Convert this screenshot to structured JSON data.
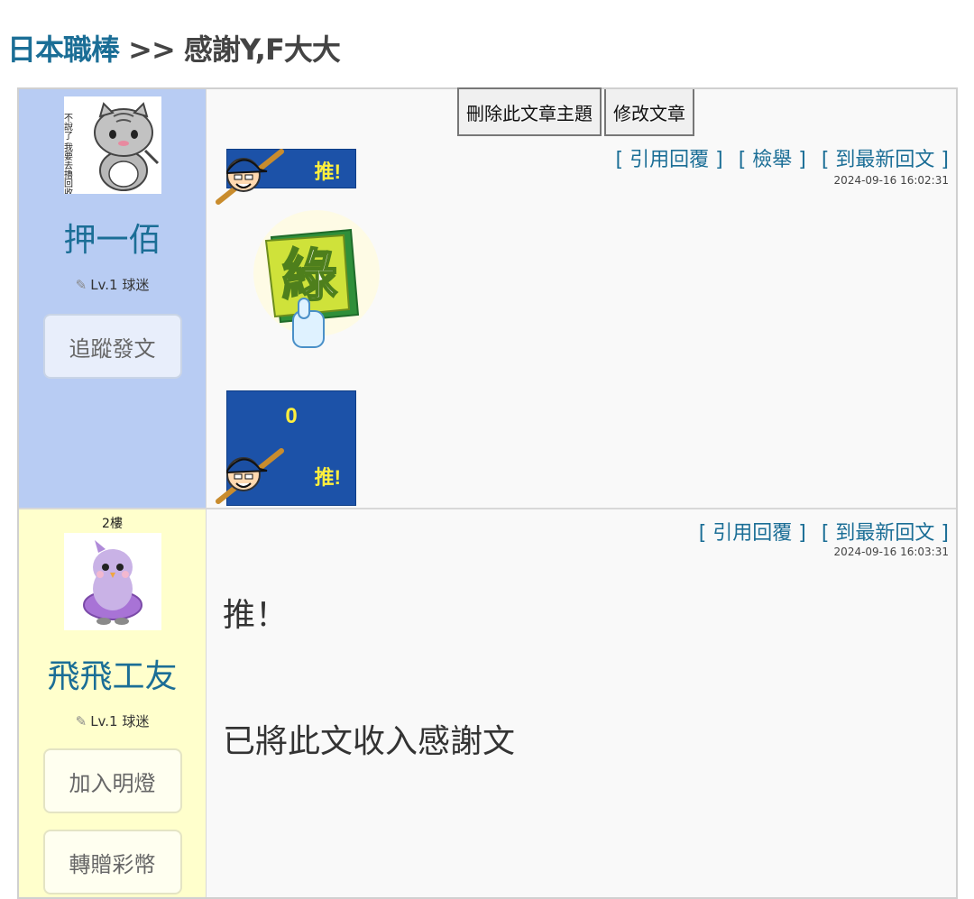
{
  "breadcrumb": {
    "board": "日本職棒",
    "separator": ">>",
    "title": "感謝Y,F大大"
  },
  "posts": [
    {
      "floor": "",
      "username": "押一佰",
      "level": "Lv.1 球迷",
      "side_buttons": [
        "追蹤發文"
      ],
      "top_buttons": [
        "刪除此文章主題",
        "修改文章"
      ],
      "actions": [
        "[ 引用回覆 ]",
        "[ 檢舉 ]",
        "[ 到最新回文 ]"
      ],
      "timestamp": "2024-09-16 16:02:31",
      "push_label": "推!",
      "sticker_text": "綠",
      "push_count": "0",
      "avatar_text": "不說了 我要去擼回收了"
    },
    {
      "floor": "2樓",
      "username": "飛飛工友",
      "level": "Lv.1 球迷",
      "side_buttons": [
        "加入明燈",
        "轉贈彩幣"
      ],
      "actions": [
        "[ 引用回覆 ]",
        "[ 到最新回文 ]"
      ],
      "timestamp": "2024-09-16 16:03:31",
      "body_lines": [
        "推！",
        "已將此文收入感謝文"
      ]
    }
  ],
  "colors": {
    "link": "#1b6e96",
    "post1_side": "#b8ccf3",
    "post2_side": "#ffffcc",
    "push_banner": "#1c52a8",
    "push_text": "#ffef3d"
  }
}
